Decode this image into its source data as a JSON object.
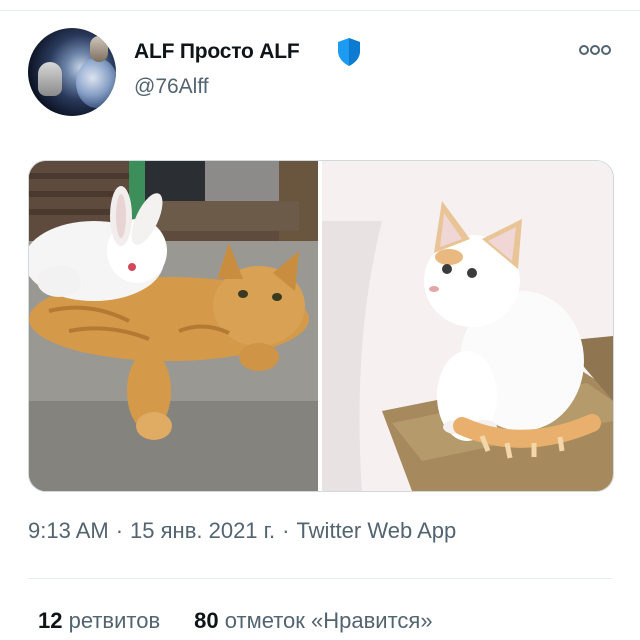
{
  "tweet": {
    "author": {
      "display_name": "ALF Просто ALF",
      "username": "@76Alff",
      "badge_icon": "shield-icon",
      "badge_color": "#1d9bf0"
    },
    "more_icon": "more-options-icon",
    "media": [
      {
        "description": "white rabbit lying on an orange tabby cat",
        "icon": "photo"
      },
      {
        "description": "white cat with orange ears and tail sitting on a cushion",
        "icon": "photo"
      }
    ],
    "timestamp": {
      "time": "9:13 AM",
      "separator": "·",
      "date": "15 янв. 2021 г.",
      "source": "Twitter Web App"
    },
    "stats": {
      "retweets_count": "12",
      "retweets_label": "ретвитов",
      "likes_count": "80",
      "likes_label": "отметок «Нравится»"
    }
  },
  "colors": {
    "text_primary": "#0f1419",
    "text_secondary": "#536471",
    "divider": "#e6ecf0"
  }
}
